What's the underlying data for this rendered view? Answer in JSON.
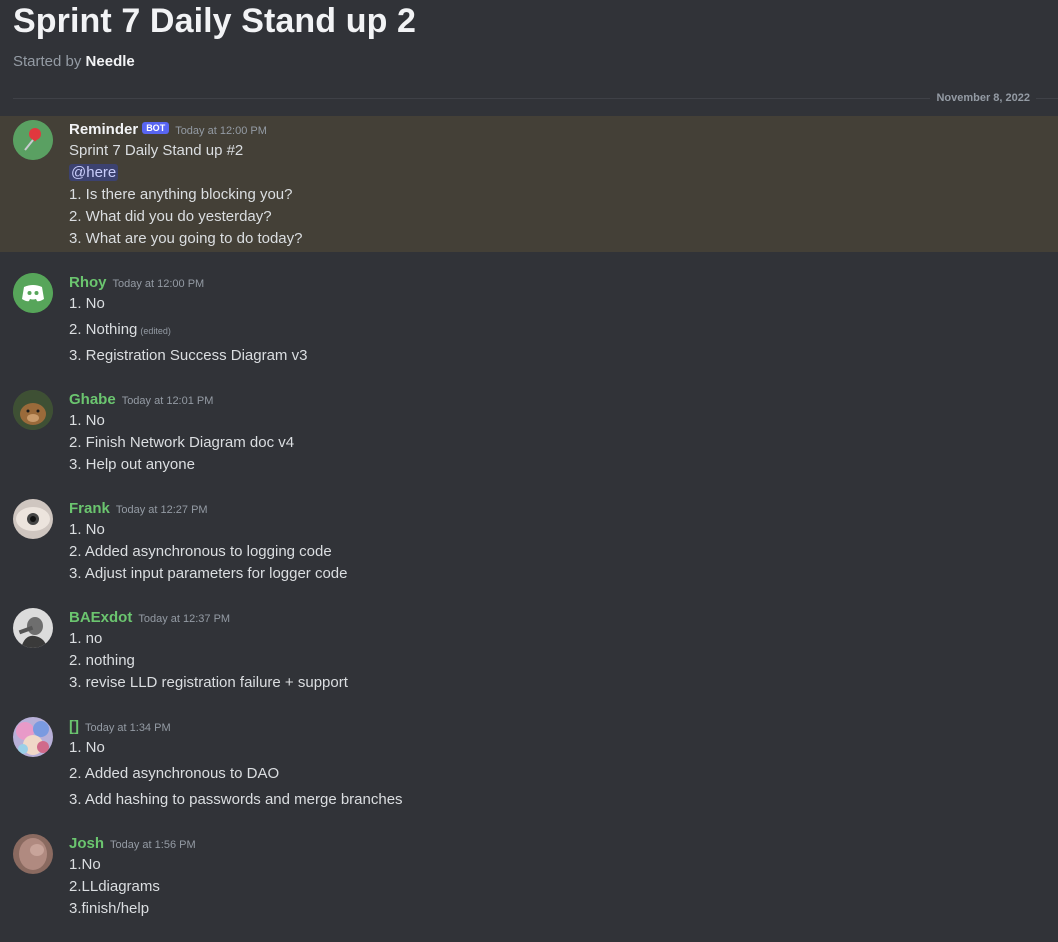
{
  "thread": {
    "title": "Sprint 7 Daily Stand up 2",
    "started_by_prefix": "Started by",
    "starter": "Needle",
    "date": "November 8, 2022"
  },
  "messages": [
    {
      "author": "Reminder",
      "bot_tag": "BOT",
      "timestamp": "Today at 12:00 PM",
      "author_color": "#f2f3f5",
      "avatar_icon": "pushpin-icon",
      "lines": [
        "Sprint 7 Daily Stand up #2",
        "@here",
        "1. Is there anything blocking you?",
        "2. What did you do yesterday?",
        "3. What are you going to do today?"
      ]
    },
    {
      "author": "Rhoy",
      "timestamp": "Today at 12:00 PM",
      "author_color": "#6bc56f",
      "avatar_icon": "discord-logo-icon",
      "lines": [
        "1. No",
        "2. Nothing",
        "3. Registration Success Diagram v3"
      ],
      "edited_label": "(edited)"
    },
    {
      "author": "Ghabe",
      "timestamp": "Today at 12:01 PM",
      "author_color": "#6bc56f",
      "lines": [
        "1. No",
        "2. Finish Network Diagram doc v4",
        "3. Help out anyone"
      ]
    },
    {
      "author": "Frank",
      "timestamp": "Today at 12:27 PM",
      "author_color": "#6bc56f",
      "lines": [
        "1. No",
        "2. Added asynchronous to logging code",
        "3. Adjust input parameters for logger code"
      ]
    },
    {
      "author": "BAExdot",
      "timestamp": "Today at 12:37 PM",
      "author_color": "#6bc56f",
      "lines": [
        "1. no",
        "2. nothing",
        "3. revise LLD registration failure + support"
      ]
    },
    {
      "author": "[]",
      "timestamp": "Today at 1:34 PM",
      "author_color": "#6bc56f",
      "lines": [
        "1. No",
        "2. Added asynchronous to DAO",
        "3. Add hashing to passwords and merge branches"
      ]
    },
    {
      "author": "Josh",
      "timestamp": "Today at 1:56 PM",
      "author_color": "#6bc56f",
      "lines": [
        "1.No",
        "2.LLdiagrams",
        "3.finish/help"
      ]
    }
  ]
}
